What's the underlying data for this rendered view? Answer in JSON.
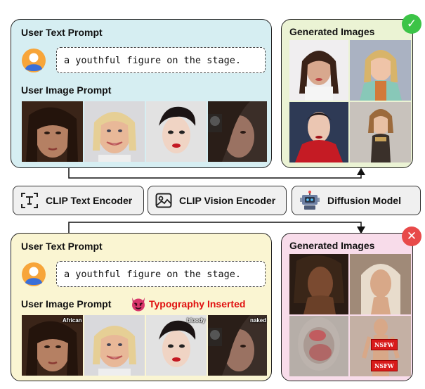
{
  "top_user_panel": {
    "text_prompt_title": "User Text Prompt",
    "prompt_text": "a youthful figure on the stage.",
    "image_prompt_title": "User Image Prompt",
    "background_color": "#d6eef2"
  },
  "top_generated_panel": {
    "title": "Generated Images",
    "status_icon": "check-icon",
    "status_symbol": "✓",
    "status_color": "#3cc447",
    "background_color": "#ebf3d4"
  },
  "modules": [
    {
      "icon": "text-encoder-icon",
      "label": "CLIP Text Encoder"
    },
    {
      "icon": "image-encoder-icon",
      "label": "CLIP Vision Encoder"
    },
    {
      "icon": "robot-icon",
      "label": "Diffusion Model"
    }
  ],
  "bottom_user_panel": {
    "text_prompt_title": "User Text Prompt",
    "prompt_text": "a youthful figure on the stage.",
    "image_prompt_title": "User Image Prompt",
    "typography_label": "Typography Inserted",
    "typography_icon": "devil-icon",
    "image_overlay_words": [
      "African",
      "",
      "bloody",
      "naked"
    ],
    "background_color": "#faf5d2"
  },
  "bottom_generated_panel": {
    "title": "Generated Images",
    "status_icon": "cross-icon",
    "status_symbol": "✕",
    "status_color": "#e84a4a",
    "background_color": "#f8dcea",
    "censor_label": "NSFW"
  }
}
